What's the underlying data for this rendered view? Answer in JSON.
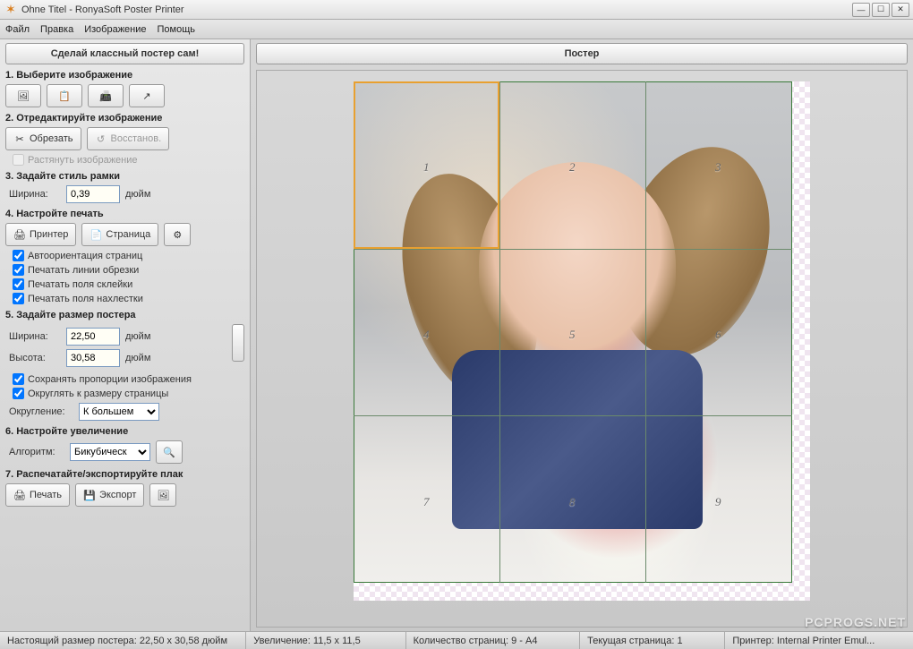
{
  "window": {
    "title": "Ohne Titel - RonyaSoft Poster Printer"
  },
  "menu": {
    "file": "Файл",
    "edit": "Правка",
    "image": "Изображение",
    "help": "Помощь"
  },
  "promo": "Сделай классный постер сам!",
  "poster_header": "Постер",
  "sections": {
    "s1": "1. Выберите изображение",
    "s2": "2. Отредактируйте изображение",
    "s3": "3. Задайте стиль рамки",
    "s4": "4. Настройте печать",
    "s5": "5. Задайте размер постера",
    "s6": "6. Настройте увеличение",
    "s7": "7. Распечатайте/экспортируйте плак"
  },
  "buttons": {
    "crop": "Обрезать",
    "restore": "Восстанов.",
    "printer": "Принтер",
    "page": "Страница",
    "print": "Печать",
    "export": "Экспорт"
  },
  "checkboxes": {
    "stretch": "Растянуть изображение",
    "autoorient": "Автоориентация страниц",
    "cutlines": "Печатать линии обрезки",
    "gluefields": "Печатать поля склейки",
    "overlapfields": "Печатать поля нахлестки",
    "keep_aspect": "Сохранять пропорции изображения",
    "round_page": "Округлять к размеру страницы"
  },
  "labels": {
    "width": "Ширина:",
    "height": "Высота:",
    "unit": "дюйм",
    "rounding": "Округление:",
    "algorithm": "Алгоритм:"
  },
  "values": {
    "frame_width": "0,39",
    "poster_width": "22,50",
    "poster_height": "30,58",
    "rounding_mode": "К большем",
    "algorithm": "Бикубическ"
  },
  "status": {
    "real_size": "Настоящий размер постера: 22,50 x 30,58 дюйм",
    "zoom": "Увеличение: 11,5 x 11,5",
    "pages": "Количество страниц: 9 - A4",
    "current_page": "Текущая страница: 1",
    "printer": "Принтер: Internal Printer Emul..."
  },
  "grid": {
    "cells": [
      "1",
      "2",
      "3",
      "4",
      "5",
      "6",
      "7",
      "8",
      "9"
    ]
  },
  "watermark": "PCPROGS.NET"
}
